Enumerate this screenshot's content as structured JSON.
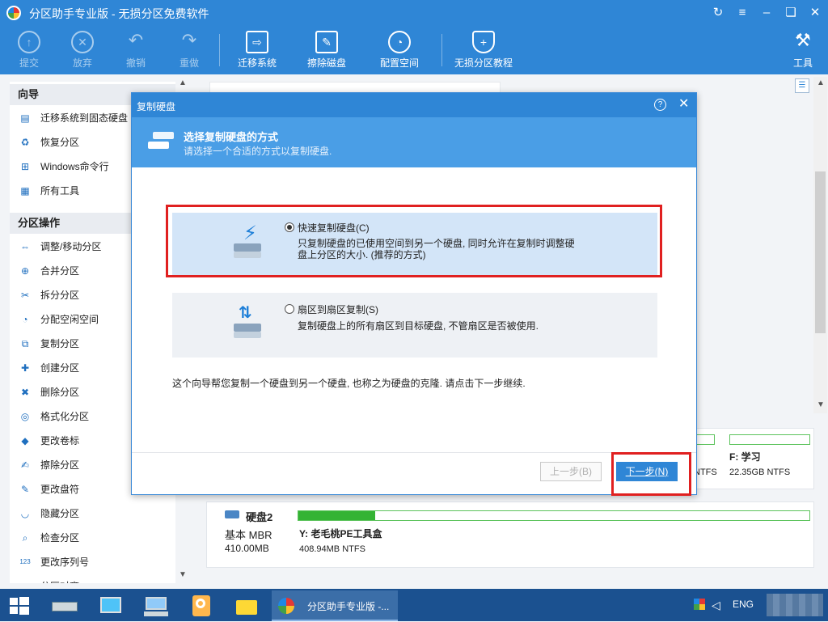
{
  "window": {
    "title": "分区助手专业版 - 无损分区免费软件"
  },
  "toolbar": {
    "commit": "提交",
    "discard": "放弃",
    "undo": "撤销",
    "redo": "重做",
    "migrate_os": "迁移系统",
    "wipe_disk": "擦除磁盘",
    "alloc_space": "配置空间",
    "tutorial": "无损分区教程",
    "tools": "工具"
  },
  "sidebar": {
    "wizard_header": "向导",
    "wizard_items": [
      "迁移系统到固态硬盘",
      "恢复分区",
      "Windows命令行",
      "所有工具"
    ],
    "ops_header": "分区操作",
    "ops_items": [
      "调整/移动分区",
      "合并分区",
      "拆分分区",
      "分配空闲空间",
      "复制分区",
      "创建分区",
      "删除分区",
      "格式化分区",
      "更改卷标",
      "擦除分区",
      "更改盘符",
      "隐藏分区",
      "检查分区",
      "更改序列号",
      "分区对齐"
    ]
  },
  "dialog": {
    "title": "复制硬盘",
    "help": "?",
    "heading": "选择复制硬盘的方式",
    "subheading": "请选择一个合适的方式以复制硬盘.",
    "option1": {
      "label": "快速复制硬盘(C)",
      "desc_line1": "只复制硬盘的已使用空间到另一个硬盘, 同时允许在复制时调整硬",
      "desc_line2": "盘上分区的大小. (推荐的方式)"
    },
    "option2": {
      "label": "扇区到扇区复制(S)",
      "desc": "复制硬盘上的所有扇区到目标硬盘, 不管扇区是否被使用."
    },
    "note": "这个向导帮您复制一个硬盘到另一个硬盘, 也称之为硬盘的克隆. 请点击下一步继续.",
    "back": "上一步(B)",
    "next": "下一步(N)"
  },
  "disks": {
    "partial_ntfs": "NTFS",
    "f_label": "F: 学习",
    "f_size": "22.35GB NTFS",
    "disk2_name": "硬盘2",
    "disk2_type": "基本 MBR",
    "disk2_size": "410.00MB",
    "y_label": "Y: 老毛桃PE工具盒",
    "y_size": "408.94MB NTFS",
    "y_used_fraction": 0.15
  },
  "taskbar": {
    "active_app": "分区助手专业版 -...",
    "lang": "ENG"
  },
  "colors": {
    "accent": "#2f86d6",
    "highlight_red": "#e02020",
    "bar_green": "#34b334"
  }
}
